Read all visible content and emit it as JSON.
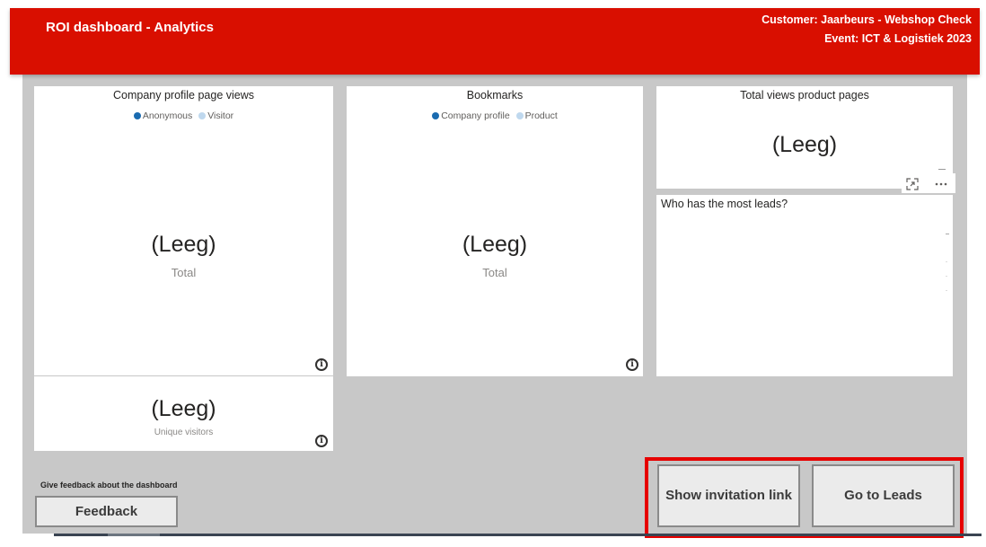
{
  "header": {
    "title": "ROI dashboard - Analytics",
    "customer": "Customer: Jaarbeurs - Webshop Check",
    "event": "Event: ICT & Logistiek 2023"
  },
  "colors": {
    "header_red": "#d90f00",
    "anonymous_dot": "#1a6bb0",
    "visitor_dot": "#bfd8ee",
    "highlight_border": "#e60000"
  },
  "company_profile_views": {
    "title": "Company profile page views",
    "legend": [
      "Anonymous",
      "Visitor"
    ],
    "value": "(Leeg)",
    "value_label": "Total",
    "info_icon": "info-icon"
  },
  "unique_visitors": {
    "value": "(Leeg)",
    "value_label": "Unique visitors",
    "info_icon": "info-icon"
  },
  "bookmarks": {
    "title": "Bookmarks",
    "legend": [
      "Company profile",
      "Product"
    ],
    "value": "(Leeg)",
    "value_label": "Total",
    "info_icon": "info-icon"
  },
  "product_views": {
    "title": "Total views product pages",
    "value": "(Leeg)",
    "focus_icon": "expand-icon",
    "more_icon": "more-options-icon"
  },
  "leads": {
    "title": "Who has the most leads?"
  },
  "feedback": {
    "prompt": "Give feedback about the dashboard",
    "button_label": "Feedback"
  },
  "actions": {
    "invitation_label": "Show invitation link",
    "leads_label": "Go to Leads"
  }
}
